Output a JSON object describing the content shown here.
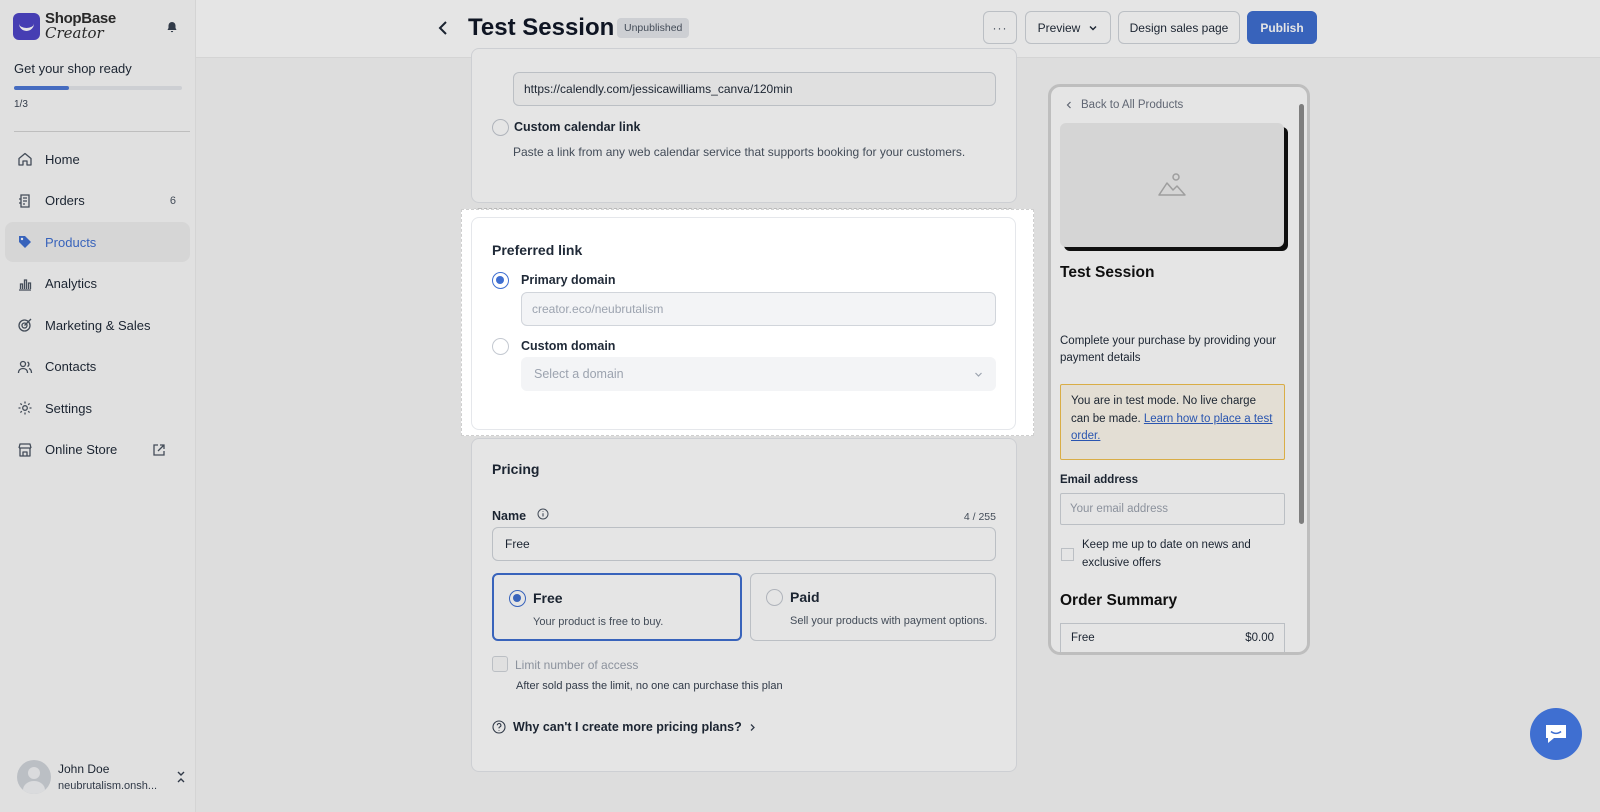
{
  "sidebar": {
    "brand_line1": "ShopBase",
    "brand_line2": "Creator",
    "onboarding_title": "Get your shop ready",
    "onboarding_progress": 0.33,
    "onboarding_step": "1/3",
    "items": [
      {
        "label": "Home",
        "icon": "home-icon"
      },
      {
        "label": "Orders",
        "icon": "orders-icon",
        "badge": "6"
      },
      {
        "label": "Products",
        "icon": "tag-icon",
        "active": true
      },
      {
        "label": "Analytics",
        "icon": "bar-chart-icon"
      },
      {
        "label": "Marketing & Sales",
        "icon": "target-icon"
      },
      {
        "label": "Contacts",
        "icon": "users-icon"
      },
      {
        "label": "Settings",
        "icon": "gear-icon"
      },
      {
        "label": "Online Store",
        "icon": "store-icon"
      }
    ],
    "user": {
      "name": "John Doe",
      "store": "neubrutalism.onsh..."
    }
  },
  "header": {
    "title": "Test Session",
    "status": "Unpublished",
    "more_label": "···",
    "preview_label": "Preview",
    "design_label": "Design sales page",
    "publish_label": "Publish"
  },
  "calendar": {
    "calendly_url": "https://calendly.com/jessicawilliams_canva/120min",
    "custom_label": "Custom calendar link",
    "custom_hint": "Paste a link from any web calendar service that supports booking for your customers."
  },
  "preferred_link": {
    "title": "Preferred link",
    "primary_label": "Primary domain",
    "primary_placeholder": "creator.eco/neubrutalism",
    "custom_label": "Custom domain",
    "select_placeholder": "Select a domain"
  },
  "pricing": {
    "title": "Pricing",
    "name_label": "Name",
    "name_count": "4 / 255",
    "name_value": "Free",
    "options": [
      {
        "title": "Free",
        "desc": "Your product is free to buy.",
        "selected": true
      },
      {
        "title": "Paid",
        "desc": "Sell your products with payment options.",
        "selected": false
      }
    ],
    "limit_label": "Limit number of access",
    "limit_hint": "After sold pass the limit, no one can purchase this plan",
    "why_label": "Why can't I create more pricing plans?"
  },
  "preview_panel": {
    "back_label": "Back to All Products",
    "product_title": "Test Session",
    "intro": "Complete your purchase by providing your payment details",
    "alert_text": "You are in test mode. No live charge can be made. ",
    "alert_link": "Learn how to place a test order.",
    "email_label": "Email address",
    "email_placeholder": "Your email address",
    "newsletter_label": "Keep me up to date on news and exclusive offers",
    "summary_title": "Order Summary",
    "summary_item": "Free",
    "summary_price": "$0.00"
  },
  "colors": {
    "accent": "#3f6fd1",
    "alert_border": "#f2c14e"
  }
}
